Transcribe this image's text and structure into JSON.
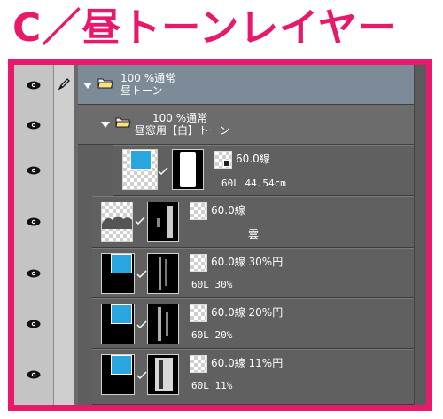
{
  "title": "C／昼トーンレイヤー",
  "colors": {
    "accent": "#e8186b",
    "blue": "#29a6e0"
  },
  "folders": [
    {
      "line1": "100 %通常",
      "line2": "昼トーン"
    },
    {
      "line1": "100 %通常",
      "line2": "昼窓用【白】トーン"
    }
  ],
  "layers": [
    {
      "tone": "60.0線",
      "sub": "60L 44.54cm"
    },
    {
      "tone": "60.0線",
      "sub": "雲"
    },
    {
      "tone": "60.0線 30%円",
      "sub": "60L 30%"
    },
    {
      "tone": "60.0線 20%円",
      "sub": "60L 20%"
    },
    {
      "tone": "60.0線 11%円",
      "sub": "60L 11%"
    }
  ],
  "icons": {
    "visibility": "eye-icon",
    "edit": "pen-icon",
    "folder": "folder-icon",
    "expand": "expand-triangle-icon"
  }
}
